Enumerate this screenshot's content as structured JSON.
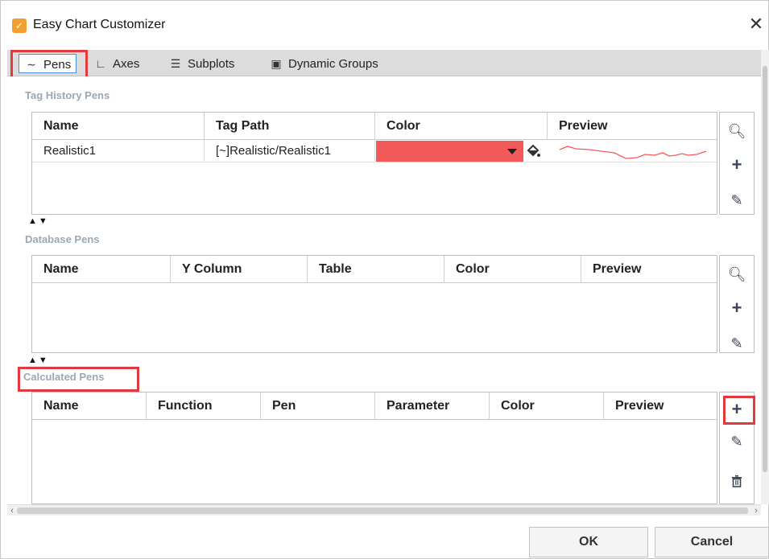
{
  "window": {
    "title": "Easy Chart Customizer",
    "close_glyph": "✕",
    "app_icon_glyph": "✓"
  },
  "tabs": [
    {
      "label": "Pens",
      "icon": "trend-line-icon",
      "glyph": "∼",
      "selected": true
    },
    {
      "label": "Axes",
      "icon": "axes-icon",
      "glyph": "∟"
    },
    {
      "label": "Subplots",
      "icon": "subplots-icon",
      "glyph": "☰"
    },
    {
      "label": "Dynamic Groups",
      "icon": "dynamic-groups-icon",
      "glyph": "▣"
    }
  ],
  "tag_history": {
    "label": "Tag History Pens",
    "columns": [
      "Name",
      "Tag Path",
      "Color",
      "Preview"
    ],
    "rows": [
      {
        "name": "Realistic1",
        "tag_path": "[~]Realistic/Realistic1",
        "color": "#f25a5a"
      }
    ]
  },
  "database": {
    "label": "Database Pens",
    "columns": [
      "Name",
      "Y Column",
      "Table",
      "Color",
      "Preview"
    ]
  },
  "calculated": {
    "label": "Calculated Pens",
    "columns": [
      "Name",
      "Function",
      "Pen",
      "Parameter",
      "Color",
      "Preview"
    ]
  },
  "buttons": {
    "ok": "OK",
    "cancel": "Cancel"
  },
  "colors": {
    "highlight": "#e0393e",
    "pen_color": "#f25a5a",
    "section_label": "#9aa8b5"
  }
}
